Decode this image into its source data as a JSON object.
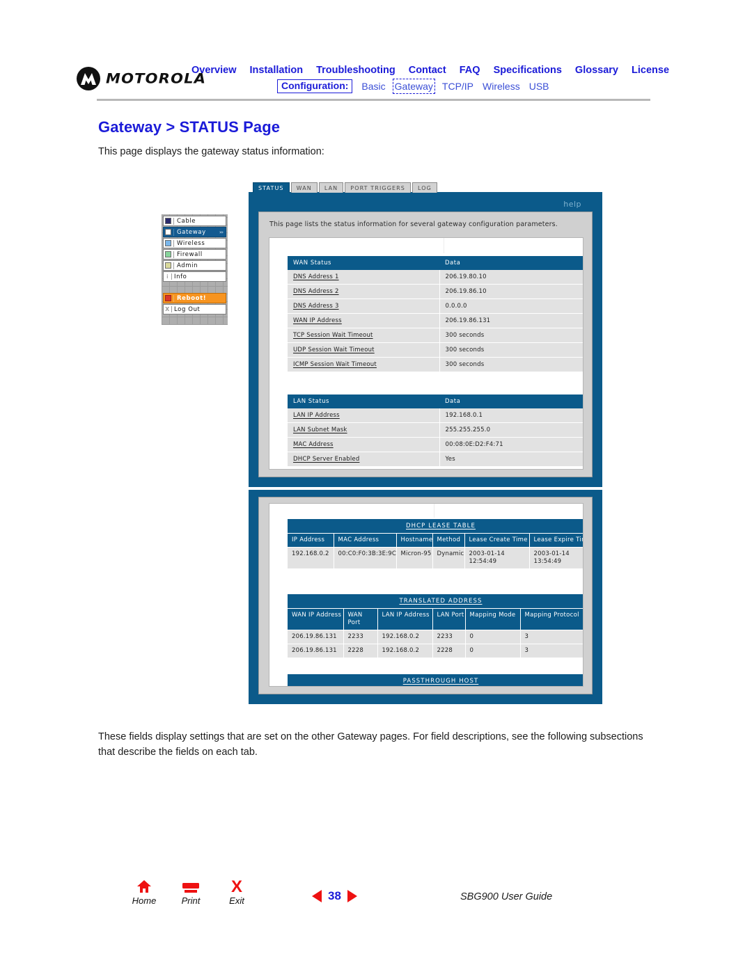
{
  "header": {
    "brand": "MOTOROLA",
    "nav_top": [
      "Overview",
      "Installation",
      "Troubleshooting",
      "Contact",
      "FAQ",
      "Specifications",
      "Glossary",
      "License"
    ],
    "config_label": "Configuration:",
    "nav_sub": [
      "Basic",
      "Gateway",
      "TCP/IP",
      "Wireless",
      "USB"
    ],
    "nav_sub_focused": "Gateway",
    "accent_blue": "#1b1bd8"
  },
  "page": {
    "title": "Gateway > STATUS Page",
    "intro": "This page displays the gateway status information:",
    "outro": "These fields display settings that are set on the other Gateway pages. For field descriptions, see the following subsections that describe the fields on each tab."
  },
  "router_ui": {
    "tabs": [
      {
        "label": "STATUS",
        "active": true
      },
      {
        "label": "WAN",
        "active": false
      },
      {
        "label": "LAN",
        "active": false
      },
      {
        "label": "PORT TRIGGERS",
        "active": false
      },
      {
        "label": "LOG",
        "active": false
      }
    ],
    "help_label": "help",
    "description": "This page lists the status information for several gateway configuration parameters.",
    "panel_blue": "#0b5a8a",
    "sidebar": [
      {
        "label": "Cable",
        "icon": "square-navy",
        "color": "#2a2a6b",
        "selected": false
      },
      {
        "label": "Gateway",
        "icon": "square-white",
        "color": "#ffffff",
        "selected": true,
        "arrows": "»›"
      },
      {
        "label": "Wireless",
        "icon": "square-lightblue",
        "color": "#79b6ea",
        "selected": false
      },
      {
        "label": "Firewall",
        "icon": "square-green",
        "color": "#86d39a",
        "selected": false
      },
      {
        "label": "Admin",
        "icon": "square-khaki",
        "color": "#d9d99b",
        "selected": false
      },
      {
        "label": "Info",
        "icon": "info-letter",
        "color": "",
        "selected": false
      },
      {
        "label": "Reboot!",
        "icon": "reboot-icon",
        "color": "#f79420",
        "selected": false
      },
      {
        "label": "Log Out",
        "icon": "close-letter",
        "color": "",
        "selected": false
      }
    ],
    "wan_status": {
      "headers": [
        "WAN Status",
        "Data"
      ],
      "rows": [
        [
          "DNS Address 1",
          "206.19.80.10"
        ],
        [
          "DNS Address 2",
          "206.19.86.10"
        ],
        [
          "DNS Address 3",
          "0.0.0.0"
        ],
        [
          "WAN IP Address",
          "206.19.86.131"
        ],
        [
          "TCP Session Wait Timeout",
          "300 seconds"
        ],
        [
          "UDP Session Wait Timeout",
          "300 seconds"
        ],
        [
          "ICMP Session Wait Timeout",
          "300 seconds"
        ]
      ]
    },
    "lan_status": {
      "headers": [
        "LAN Status",
        "Data"
      ],
      "rows": [
        [
          "LAN IP Address",
          "192.168.0.1"
        ],
        [
          "LAN Subnet Mask",
          "255.255.255.0"
        ],
        [
          "MAC Address",
          "00:08:0E:D2:F4:71"
        ],
        [
          "DHCP Server Enabled",
          "Yes"
        ]
      ]
    },
    "dhcp_lease_table": {
      "caption": "DHCP LEASE TABLE",
      "headers": [
        "IP Address",
        "MAC Address",
        "Hostname",
        "Method",
        "Lease Create Time",
        "Lease Expire Time"
      ],
      "rows": [
        [
          "192.168.0.2",
          "00:C0:F0:3B:3E:9C",
          "Micron-95",
          "Dynamic",
          "2003-01-14 12:54:49",
          "2003-01-14 13:54:49"
        ]
      ]
    },
    "translated_address": {
      "caption": "TRANSLATED ADDRESS",
      "headers": [
        "WAN IP Address",
        "WAN Port",
        "LAN IP Address",
        "LAN Port",
        "Mapping Mode",
        "Mapping Protocol"
      ],
      "rows": [
        [
          "206.19.86.131",
          "2233",
          "192.168.0.2",
          "2233",
          "0",
          "3"
        ],
        [
          "206.19.86.131",
          "2228",
          "192.168.0.2",
          "2228",
          "0",
          "3"
        ]
      ]
    },
    "passthrough_host": {
      "caption": "PASSTHROUGH HOST"
    }
  },
  "footer": {
    "buttons": [
      {
        "label": "Home",
        "icon": "home-icon"
      },
      {
        "label": "Print",
        "icon": "print-icon"
      },
      {
        "label": "Exit",
        "icon": "close-icon"
      }
    ],
    "page_number": "38",
    "guide_label": "SBG900 User Guide",
    "arrow_color": "#ee1111"
  }
}
